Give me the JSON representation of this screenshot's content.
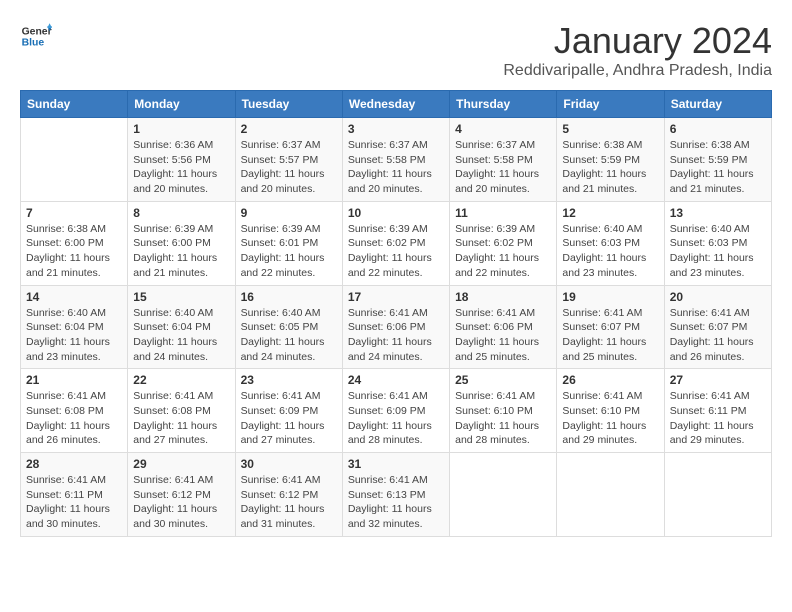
{
  "header": {
    "logo_line1": "General",
    "logo_line2": "Blue",
    "title": "January 2024",
    "subtitle": "Reddivaripalle, Andhra Pradesh, India"
  },
  "days_of_week": [
    "Sunday",
    "Monday",
    "Tuesday",
    "Wednesday",
    "Thursday",
    "Friday",
    "Saturday"
  ],
  "weeks": [
    [
      {
        "day": "",
        "detail": ""
      },
      {
        "day": "1",
        "detail": "Sunrise: 6:36 AM\nSunset: 5:56 PM\nDaylight: 11 hours\nand 20 minutes."
      },
      {
        "day": "2",
        "detail": "Sunrise: 6:37 AM\nSunset: 5:57 PM\nDaylight: 11 hours\nand 20 minutes."
      },
      {
        "day": "3",
        "detail": "Sunrise: 6:37 AM\nSunset: 5:58 PM\nDaylight: 11 hours\nand 20 minutes."
      },
      {
        "day": "4",
        "detail": "Sunrise: 6:37 AM\nSunset: 5:58 PM\nDaylight: 11 hours\nand 20 minutes."
      },
      {
        "day": "5",
        "detail": "Sunrise: 6:38 AM\nSunset: 5:59 PM\nDaylight: 11 hours\nand 21 minutes."
      },
      {
        "day": "6",
        "detail": "Sunrise: 6:38 AM\nSunset: 5:59 PM\nDaylight: 11 hours\nand 21 minutes."
      }
    ],
    [
      {
        "day": "7",
        "detail": "Sunrise: 6:38 AM\nSunset: 6:00 PM\nDaylight: 11 hours\nand 21 minutes."
      },
      {
        "day": "8",
        "detail": "Sunrise: 6:39 AM\nSunset: 6:00 PM\nDaylight: 11 hours\nand 21 minutes."
      },
      {
        "day": "9",
        "detail": "Sunrise: 6:39 AM\nSunset: 6:01 PM\nDaylight: 11 hours\nand 22 minutes."
      },
      {
        "day": "10",
        "detail": "Sunrise: 6:39 AM\nSunset: 6:02 PM\nDaylight: 11 hours\nand 22 minutes."
      },
      {
        "day": "11",
        "detail": "Sunrise: 6:39 AM\nSunset: 6:02 PM\nDaylight: 11 hours\nand 22 minutes."
      },
      {
        "day": "12",
        "detail": "Sunrise: 6:40 AM\nSunset: 6:03 PM\nDaylight: 11 hours\nand 23 minutes."
      },
      {
        "day": "13",
        "detail": "Sunrise: 6:40 AM\nSunset: 6:03 PM\nDaylight: 11 hours\nand 23 minutes."
      }
    ],
    [
      {
        "day": "14",
        "detail": "Sunrise: 6:40 AM\nSunset: 6:04 PM\nDaylight: 11 hours\nand 23 minutes."
      },
      {
        "day": "15",
        "detail": "Sunrise: 6:40 AM\nSunset: 6:04 PM\nDaylight: 11 hours\nand 24 minutes."
      },
      {
        "day": "16",
        "detail": "Sunrise: 6:40 AM\nSunset: 6:05 PM\nDaylight: 11 hours\nand 24 minutes."
      },
      {
        "day": "17",
        "detail": "Sunrise: 6:41 AM\nSunset: 6:06 PM\nDaylight: 11 hours\nand 24 minutes."
      },
      {
        "day": "18",
        "detail": "Sunrise: 6:41 AM\nSunset: 6:06 PM\nDaylight: 11 hours\nand 25 minutes."
      },
      {
        "day": "19",
        "detail": "Sunrise: 6:41 AM\nSunset: 6:07 PM\nDaylight: 11 hours\nand 25 minutes."
      },
      {
        "day": "20",
        "detail": "Sunrise: 6:41 AM\nSunset: 6:07 PM\nDaylight: 11 hours\nand 26 minutes."
      }
    ],
    [
      {
        "day": "21",
        "detail": "Sunrise: 6:41 AM\nSunset: 6:08 PM\nDaylight: 11 hours\nand 26 minutes."
      },
      {
        "day": "22",
        "detail": "Sunrise: 6:41 AM\nSunset: 6:08 PM\nDaylight: 11 hours\nand 27 minutes."
      },
      {
        "day": "23",
        "detail": "Sunrise: 6:41 AM\nSunset: 6:09 PM\nDaylight: 11 hours\nand 27 minutes."
      },
      {
        "day": "24",
        "detail": "Sunrise: 6:41 AM\nSunset: 6:09 PM\nDaylight: 11 hours\nand 28 minutes."
      },
      {
        "day": "25",
        "detail": "Sunrise: 6:41 AM\nSunset: 6:10 PM\nDaylight: 11 hours\nand 28 minutes."
      },
      {
        "day": "26",
        "detail": "Sunrise: 6:41 AM\nSunset: 6:10 PM\nDaylight: 11 hours\nand 29 minutes."
      },
      {
        "day": "27",
        "detail": "Sunrise: 6:41 AM\nSunset: 6:11 PM\nDaylight: 11 hours\nand 29 minutes."
      }
    ],
    [
      {
        "day": "28",
        "detail": "Sunrise: 6:41 AM\nSunset: 6:11 PM\nDaylight: 11 hours\nand 30 minutes."
      },
      {
        "day": "29",
        "detail": "Sunrise: 6:41 AM\nSunset: 6:12 PM\nDaylight: 11 hours\nand 30 minutes."
      },
      {
        "day": "30",
        "detail": "Sunrise: 6:41 AM\nSunset: 6:12 PM\nDaylight: 11 hours\nand 31 minutes."
      },
      {
        "day": "31",
        "detail": "Sunrise: 6:41 AM\nSunset: 6:13 PM\nDaylight: 11 hours\nand 32 minutes."
      },
      {
        "day": "",
        "detail": ""
      },
      {
        "day": "",
        "detail": ""
      },
      {
        "day": "",
        "detail": ""
      }
    ]
  ]
}
